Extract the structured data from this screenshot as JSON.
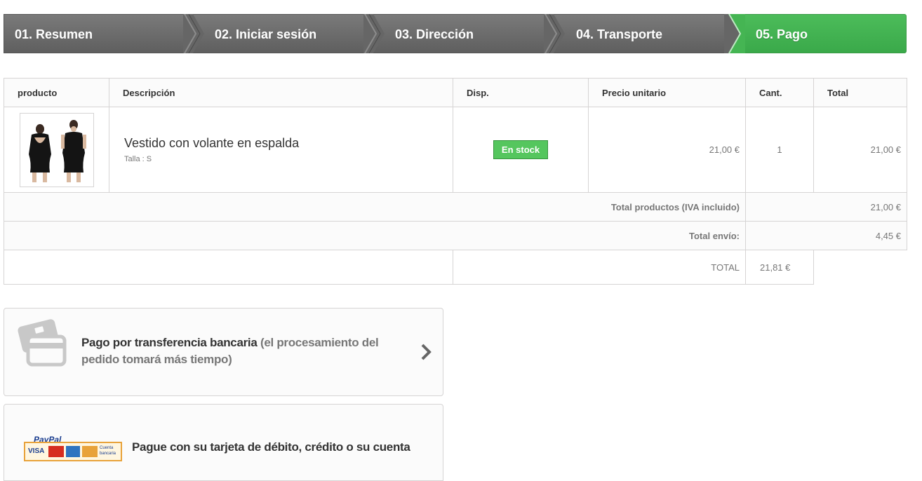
{
  "steps": [
    {
      "label": "01. Resumen",
      "active": false
    },
    {
      "label": "02. Iniciar sesión",
      "active": false
    },
    {
      "label": "03. Dirección",
      "active": false
    },
    {
      "label": "04. Transporte",
      "active": false
    },
    {
      "label": "05. Pago",
      "active": true
    }
  ],
  "cart": {
    "headers": [
      "producto",
      "Descripción",
      "Disp.",
      "Precio unitario",
      "Cant.",
      "Total"
    ],
    "item": {
      "name": "Vestido con volante en espalda",
      "size": "Talla : S",
      "availability": "En stock",
      "unit_price": "21,00 €",
      "quantity": "1",
      "total": "21,00 €"
    },
    "total_products_label": "Total productos (IVA incluido)",
    "total_products_value": "21,00 €",
    "shipping_label": "Total envío:",
    "shipping_value": "4,45 €",
    "grand_total_label": "TOTAL",
    "grand_total_value": "21,81 €"
  },
  "payments": {
    "bankwire_strong": "Pago por transferencia bancaria",
    "bankwire_muted": "(el procesamiento del pedido tomará más tiempo)",
    "paypal_text": "Pague con su tarjeta de débito, crédito o su cuenta",
    "paypal_logo_text": "PayPal",
    "card_visa": "VISA",
    "card_bank": "Cuenta bancaria"
  },
  "colors": {
    "step_active": "#45b553",
    "step_inactive": "#6b6b6b",
    "stock_badge": "#55c65e"
  },
  "icons": {
    "bankwire": "credit-card-icon",
    "chevron": "chevron-right-icon"
  }
}
